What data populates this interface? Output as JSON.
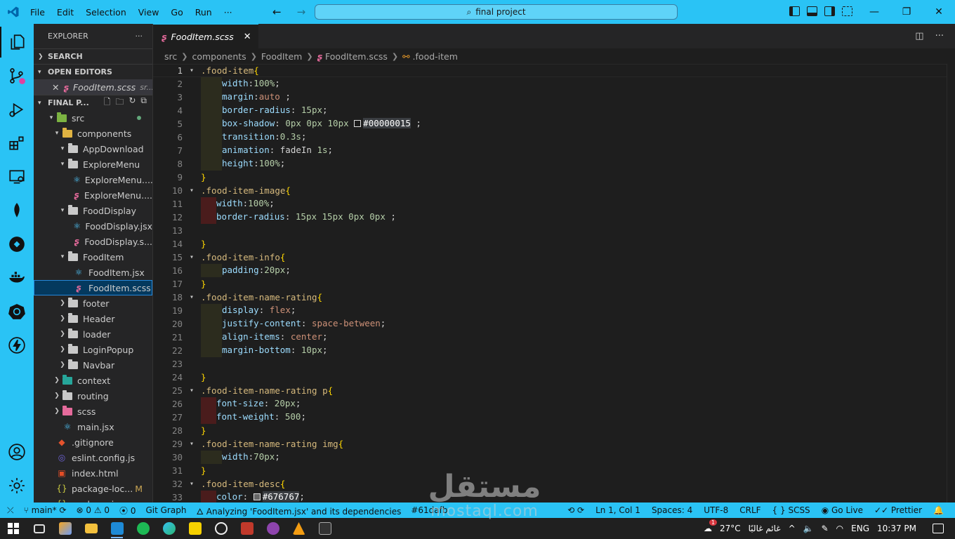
{
  "titlebar": {
    "menu": [
      "File",
      "Edit",
      "Selection",
      "View",
      "Go",
      "Run",
      "···"
    ],
    "search": "final project",
    "win_min": "—",
    "win_max": "❐",
    "win_close": "✕"
  },
  "sidebar": {
    "title": "EXPLORER",
    "more": "···",
    "search_section": "SEARCH",
    "open_editors_section": "OPEN EDITORS",
    "open_editor": {
      "name": "FoodItem.scss",
      "path": "sr..."
    },
    "project_section": "FINAL P...",
    "tree": [
      {
        "label": "src",
        "depth": 0,
        "type": "folder",
        "kind": "src",
        "open": true,
        "dot": true
      },
      {
        "label": "components",
        "depth": 1,
        "type": "folder",
        "kind": "comp",
        "open": true
      },
      {
        "label": "AppDownload",
        "depth": 2,
        "type": "folder",
        "kind": "plain",
        "open": true
      },
      {
        "label": "ExploreMenu",
        "depth": 2,
        "type": "folder",
        "kind": "plain",
        "open": true
      },
      {
        "label": "ExploreMenu....",
        "depth": 3,
        "type": "react"
      },
      {
        "label": "ExploreMenu....",
        "depth": 3,
        "type": "sass"
      },
      {
        "label": "FoodDisplay",
        "depth": 2,
        "type": "folder",
        "kind": "plain",
        "open": true
      },
      {
        "label": "FoodDisplay.jsx",
        "depth": 3,
        "type": "react"
      },
      {
        "label": "FoodDisplay.s...",
        "depth": 3,
        "type": "sass"
      },
      {
        "label": "FoodItem",
        "depth": 2,
        "type": "folder",
        "kind": "plain",
        "open": true
      },
      {
        "label": "FoodItem.jsx",
        "depth": 3,
        "type": "react"
      },
      {
        "label": "FoodItem.scss",
        "depth": 3,
        "type": "sass",
        "selected": true
      },
      {
        "label": "footer",
        "depth": 2,
        "type": "folder",
        "kind": "plain",
        "open": false
      },
      {
        "label": "Header",
        "depth": 2,
        "type": "folder",
        "kind": "plain",
        "open": false
      },
      {
        "label": "loader",
        "depth": 2,
        "type": "folder",
        "kind": "plain",
        "open": false
      },
      {
        "label": "LoginPopup",
        "depth": 2,
        "type": "folder",
        "kind": "plain",
        "open": false
      },
      {
        "label": "Navbar",
        "depth": 2,
        "type": "folder",
        "kind": "plain",
        "open": false
      },
      {
        "label": "context",
        "depth": 1,
        "type": "folder",
        "kind": "ctx",
        "open": false
      },
      {
        "label": "routing",
        "depth": 1,
        "type": "folder",
        "kind": "plain",
        "open": false
      },
      {
        "label": "scss",
        "depth": 1,
        "type": "folder",
        "kind": "scss",
        "open": false
      },
      {
        "label": "main.jsx",
        "depth": 1,
        "type": "react"
      },
      {
        "label": ".gitignore",
        "depth": 0,
        "type": "git"
      },
      {
        "label": "eslint.config.js",
        "depth": 0,
        "type": "eslint"
      },
      {
        "label": "index.html",
        "depth": 0,
        "type": "html"
      },
      {
        "label": "package-loc...",
        "depth": 0,
        "type": "json",
        "mod": "M"
      },
      {
        "label": "package.json",
        "depth": 0,
        "type": "json"
      }
    ]
  },
  "editor": {
    "tab": "FoodItem.scss",
    "tab_close": "✕",
    "breadcrumb": [
      "src",
      "components",
      "FoodItem",
      "FoodItem.scss",
      ".food-item"
    ],
    "current_line": 1,
    "lines": [
      {
        "n": 1,
        "fold": true,
        "ind": "",
        "parts": [
          [
            "sel",
            ".food-item"
          ],
          [
            "brace",
            "{"
          ]
        ]
      },
      {
        "n": 2,
        "ind": "y",
        "parts": [
          [
            "prop",
            "width"
          ],
          [
            "txt",
            ":"
          ],
          [
            "num",
            "100%"
          ],
          [
            "txt",
            ";"
          ]
        ]
      },
      {
        "n": 3,
        "ind": "y",
        "parts": [
          [
            "prop",
            "margin"
          ],
          [
            "txt",
            ":"
          ],
          [
            "val",
            "auto"
          ],
          [
            "txt",
            " ;"
          ]
        ]
      },
      {
        "n": 4,
        "ind": "y",
        "parts": [
          [
            "prop",
            "border-radius"
          ],
          [
            "txt",
            ": "
          ],
          [
            "num",
            "15px"
          ],
          [
            "txt",
            ";"
          ]
        ]
      },
      {
        "n": 5,
        "ind": "y",
        "parts": [
          [
            "prop",
            "box-shadow"
          ],
          [
            "txt",
            ": "
          ],
          [
            "num",
            "0px 0px 10px"
          ],
          [
            "txt",
            " "
          ],
          [
            "swatch",
            "#00000015"
          ],
          [
            "hexhi",
            "#00000015"
          ],
          [
            "txt",
            " ;"
          ]
        ]
      },
      {
        "n": 6,
        "ind": "y",
        "parts": [
          [
            "prop",
            "transition"
          ],
          [
            "txt",
            ":"
          ],
          [
            "num",
            "0.3s"
          ],
          [
            "txt",
            ";"
          ]
        ]
      },
      {
        "n": 7,
        "ind": "y",
        "parts": [
          [
            "prop",
            "animation"
          ],
          [
            "txt",
            ": fadeIn "
          ],
          [
            "num",
            "1s"
          ],
          [
            "txt",
            ";"
          ]
        ]
      },
      {
        "n": 8,
        "ind": "y",
        "parts": [
          [
            "prop",
            "height"
          ],
          [
            "txt",
            ":"
          ],
          [
            "num",
            "100%"
          ],
          [
            "txt",
            ";"
          ]
        ]
      },
      {
        "n": 9,
        "ind": "",
        "parts": [
          [
            "brace",
            "}"
          ]
        ]
      },
      {
        "n": 10,
        "fold": true,
        "ind": "",
        "parts": [
          [
            "sel",
            ".food-item-image"
          ],
          [
            "brace",
            "{"
          ]
        ]
      },
      {
        "n": 11,
        "ind": "r",
        "parts": [
          [
            "prop",
            "width"
          ],
          [
            "txt",
            ":"
          ],
          [
            "num",
            "100%"
          ],
          [
            "txt",
            ";"
          ]
        ]
      },
      {
        "n": 12,
        "ind": "r",
        "parts": [
          [
            "prop",
            "border-radius"
          ],
          [
            "txt",
            ": "
          ],
          [
            "num",
            "15px 15px 0px 0px"
          ],
          [
            "txt",
            " ;"
          ]
        ]
      },
      {
        "n": 13,
        "ind": "",
        "parts": []
      },
      {
        "n": 14,
        "ind": "",
        "parts": [
          [
            "brace",
            "}"
          ]
        ]
      },
      {
        "n": 15,
        "fold": true,
        "ind": "",
        "parts": [
          [
            "sel",
            ".food-item-info"
          ],
          [
            "brace",
            "{"
          ]
        ]
      },
      {
        "n": 16,
        "ind": "y",
        "parts": [
          [
            "prop",
            "padding"
          ],
          [
            "txt",
            ":"
          ],
          [
            "num",
            "20px"
          ],
          [
            "txt",
            ";"
          ]
        ]
      },
      {
        "n": 17,
        "ind": "",
        "parts": [
          [
            "brace",
            "}"
          ]
        ]
      },
      {
        "n": 18,
        "fold": true,
        "ind": "",
        "parts": [
          [
            "sel",
            ".food-item-name-rating"
          ],
          [
            "brace",
            "{"
          ]
        ]
      },
      {
        "n": 19,
        "ind": "y",
        "parts": [
          [
            "prop",
            "display"
          ],
          [
            "txt",
            ": "
          ],
          [
            "val",
            "flex"
          ],
          [
            "txt",
            ";"
          ]
        ]
      },
      {
        "n": 20,
        "ind": "y",
        "parts": [
          [
            "prop",
            "justify-content"
          ],
          [
            "txt",
            ": "
          ],
          [
            "val",
            "space-between"
          ],
          [
            "txt",
            ";"
          ]
        ]
      },
      {
        "n": 21,
        "ind": "y",
        "parts": [
          [
            "prop",
            "align-items"
          ],
          [
            "txt",
            ": "
          ],
          [
            "val",
            "center"
          ],
          [
            "txt",
            ";"
          ]
        ]
      },
      {
        "n": 22,
        "ind": "y",
        "parts": [
          [
            "prop",
            "margin-bottom"
          ],
          [
            "txt",
            ": "
          ],
          [
            "num",
            "10px"
          ],
          [
            "txt",
            ";"
          ]
        ]
      },
      {
        "n": 23,
        "ind": "",
        "parts": []
      },
      {
        "n": 24,
        "ind": "",
        "parts": [
          [
            "brace",
            "}"
          ]
        ]
      },
      {
        "n": 25,
        "fold": true,
        "ind": "",
        "parts": [
          [
            "sel",
            ".food-item-name-rating p"
          ],
          [
            "brace",
            "{"
          ]
        ]
      },
      {
        "n": 26,
        "ind": "r",
        "parts": [
          [
            "prop",
            "font-size"
          ],
          [
            "txt",
            ": "
          ],
          [
            "num",
            "20px"
          ],
          [
            "txt",
            ";"
          ]
        ]
      },
      {
        "n": 27,
        "ind": "r",
        "parts": [
          [
            "prop",
            "font-weight"
          ],
          [
            "txt",
            ": "
          ],
          [
            "num",
            "500"
          ],
          [
            "txt",
            ";"
          ]
        ]
      },
      {
        "n": 28,
        "ind": "",
        "parts": [
          [
            "brace",
            "}"
          ]
        ]
      },
      {
        "n": 29,
        "fold": true,
        "ind": "",
        "parts": [
          [
            "sel",
            ".food-item-name-rating img"
          ],
          [
            "brace",
            "{"
          ]
        ]
      },
      {
        "n": 30,
        "ind": "y",
        "parts": [
          [
            "prop",
            "width"
          ],
          [
            "txt",
            ":"
          ],
          [
            "num",
            "70px"
          ],
          [
            "txt",
            ";"
          ]
        ]
      },
      {
        "n": 31,
        "ind": "",
        "parts": [
          [
            "brace",
            "}"
          ]
        ]
      },
      {
        "n": 32,
        "fold": true,
        "ind": "",
        "parts": [
          [
            "sel",
            ".food-item-desc"
          ],
          [
            "brace",
            "{"
          ]
        ]
      },
      {
        "n": 33,
        "ind": "r",
        "parts": [
          [
            "prop",
            "color"
          ],
          [
            "txt",
            ": "
          ],
          [
            "swatch",
            "#676767"
          ],
          [
            "hexhi",
            "#676767"
          ],
          [
            "txt",
            ";"
          ]
        ]
      }
    ]
  },
  "statusbar": {
    "remote": "⤫",
    "branch": "main*",
    "sync": "⟳",
    "errors": "⊗ 0 ⚠ 0",
    "ports": "⦿ 0",
    "git_graph": "Git Graph",
    "analyzing": "Analyzing 'FoodItem.jsx' and its dependencies",
    "commit": "#61dafb",
    "sync_right": "⟲ ⟳",
    "position": "Ln 1, Col 1",
    "spaces": "Spaces: 4",
    "encoding": "UTF-8",
    "eol": "CRLF",
    "language": "{ }  SCSS",
    "golive": "Go Live",
    "prettier": "Prettier",
    "bell": "🔔"
  },
  "taskbar": {
    "weather_temp": "27°C",
    "weather_text": "غائم غالبًا",
    "lang": "ENG",
    "time": "10:37 PM",
    "notification_count": "1"
  },
  "watermark": {
    "arabic": "مستقل",
    "latin": "mostaql.com"
  },
  "colors": {
    "accent": "#2ac3f5",
    "editor_bg": "#1e1e1e",
    "sidebar_bg": "#252526"
  }
}
